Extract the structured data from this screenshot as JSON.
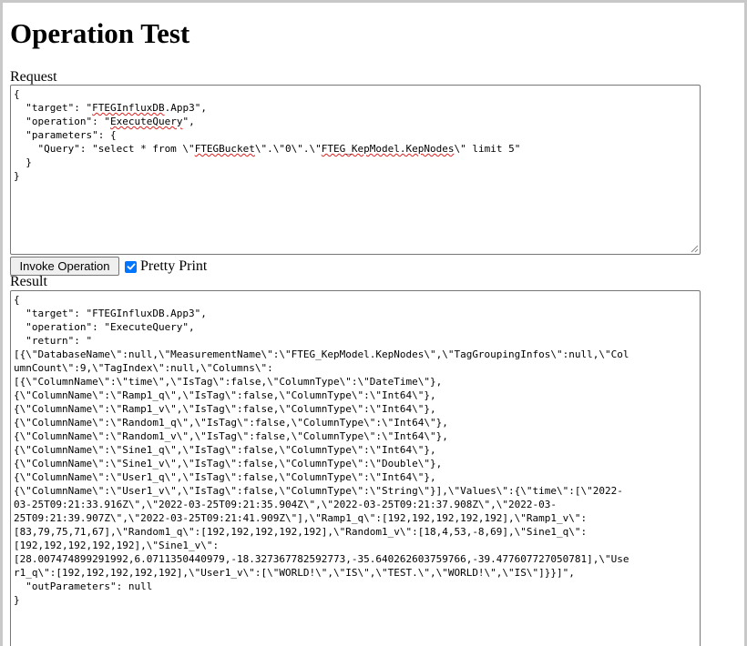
{
  "page": {
    "title": "Operation Test"
  },
  "request": {
    "label": "Request",
    "line1": "{",
    "line2a": "  \"target\": \"",
    "line2b": "FTEGInfluxDB",
    "line2c": ".App3\",",
    "line3a": "  \"operation\": \"",
    "line3b": "ExecuteQuery",
    "line3c": "\",",
    "line4": "  \"parameters\": {",
    "line5a": "    \"Query\": \"select * from \\\"",
    "line5b": "FTEGBucket",
    "line5c": "\\\".\\\"0\\\".\\\"",
    "line5d": "FTEG_KepModel.KepNodes",
    "line5e": "\\\" limit 5\"",
    "line6": "  }",
    "line7": "}"
  },
  "controls": {
    "invoke_label": "Invoke Operation",
    "pretty_print_label": "Pretty Print",
    "pretty_print_checked": true
  },
  "result": {
    "label": "Result",
    "lines": [
      "{",
      "  \"target\": \"FTEGInfluxDB.App3\",",
      "  \"operation\": \"ExecuteQuery\",",
      "  \"return\": \"",
      "[{\\\"DatabaseName\\\":null,\\\"MeasurementName\\\":\\\"FTEG_KepModel.KepNodes\\\",\\\"TagGroupingInfos\\\":null,\\\"Col",
      "umnCount\\\":9,\\\"TagIndex\\\":null,\\\"Columns\\\":",
      "[{\\\"ColumnName\\\":\\\"time\\\",\\\"IsTag\\\":false,\\\"ColumnType\\\":\\\"DateTime\\\"},",
      "{\\\"ColumnName\\\":\\\"Ramp1_q\\\",\\\"IsTag\\\":false,\\\"ColumnType\\\":\\\"Int64\\\"},",
      "{\\\"ColumnName\\\":\\\"Ramp1_v\\\",\\\"IsTag\\\":false,\\\"ColumnType\\\":\\\"Int64\\\"},",
      "{\\\"ColumnName\\\":\\\"Random1_q\\\",\\\"IsTag\\\":false,\\\"ColumnType\\\":\\\"Int64\\\"},",
      "{\\\"ColumnName\\\":\\\"Random1_v\\\",\\\"IsTag\\\":false,\\\"ColumnType\\\":\\\"Int64\\\"},",
      "{\\\"ColumnName\\\":\\\"Sine1_q\\\",\\\"IsTag\\\":false,\\\"ColumnType\\\":\\\"Int64\\\"},",
      "{\\\"ColumnName\\\":\\\"Sine1_v\\\",\\\"IsTag\\\":false,\\\"ColumnType\\\":\\\"Double\\\"},",
      "{\\\"ColumnName\\\":\\\"User1_q\\\",\\\"IsTag\\\":false,\\\"ColumnType\\\":\\\"Int64\\\"},",
      "{\\\"ColumnName\\\":\\\"User1_v\\\",\\\"IsTag\\\":false,\\\"ColumnType\\\":\\\"String\\\"}],\\\"Values\\\":{\\\"time\\\":[\\\"2022-",
      "03-25T09:21:33.916Z\\\",\\\"2022-03-25T09:21:35.904Z\\\",\\\"2022-03-25T09:21:37.908Z\\\",\\\"2022-03-",
      "25T09:21:39.907Z\\\",\\\"2022-03-25T09:21:41.909Z\\\"],\\\"Ramp1_q\\\":[192,192,192,192,192],\\\"Ramp1_v\\\":",
      "[83,79,75,71,67],\\\"Random1_q\\\":[192,192,192,192,192],\\\"Random1_v\\\":[18,4,53,-8,69],\\\"Sine1_q\\\":",
      "[192,192,192,192,192],\\\"Sine1_v\\\":",
      "[28.007474899291992,6.0711350440979,-18.327367782592773,-35.640262603759766,-39.477607727050781],\\\"Use",
      "r1_q\\\":[192,192,192,192,192],\\\"User1_v\\\":[\\\"WORLD!\\\",\\\"IS\\\",\\\"TEST.\\\",\\\"WORLD!\\\",\\\"IS\\\"]}}]\",",
      "  \"outParameters\": null",
      "}"
    ]
  }
}
